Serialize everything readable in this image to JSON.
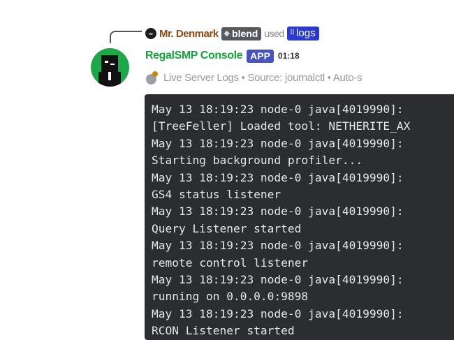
{
  "reply": {
    "author": "Mr. Denmark",
    "command_app": "blend",
    "used_word": "used",
    "command": "logs"
  },
  "message": {
    "bot_name": "RegalSMP Console",
    "app_tag": "APP",
    "timestamp": "01:18",
    "description": "Live Server Logs • Source: journalctl • Auto-s",
    "description_icon": "satellite-antenna-icon"
  },
  "log_lines": [
    "May 13 18:19:23 node-0 java[4019990]:",
    "[TreeFeller] Loaded tool: NETHERITE_AX",
    "May 13 18:19:23 node-0 java[4019990]:",
    "Starting background profiler...",
    "May 13 18:19:23 node-0 java[4019990]:",
    "GS4 status listener",
    "May 13 18:19:23 node-0 java[4019990]:",
    "Query Listener started",
    "May 13 18:19:23 node-0 java[4019990]:",
    "remote control listener",
    "May 13 18:19:23 node-0 java[4019990]:",
    "running on 0.0.0.0:9898",
    "May 13 18:19:23 node-0 java[4019990]:",
    "RCON Listener started"
  ],
  "colors": {
    "bot_name": "#17a23d",
    "app_tag": "#4752c4",
    "code_bg": "#2b2d31",
    "reply_author": "#8a4b14",
    "slash_pill": "#2a3ad0"
  }
}
